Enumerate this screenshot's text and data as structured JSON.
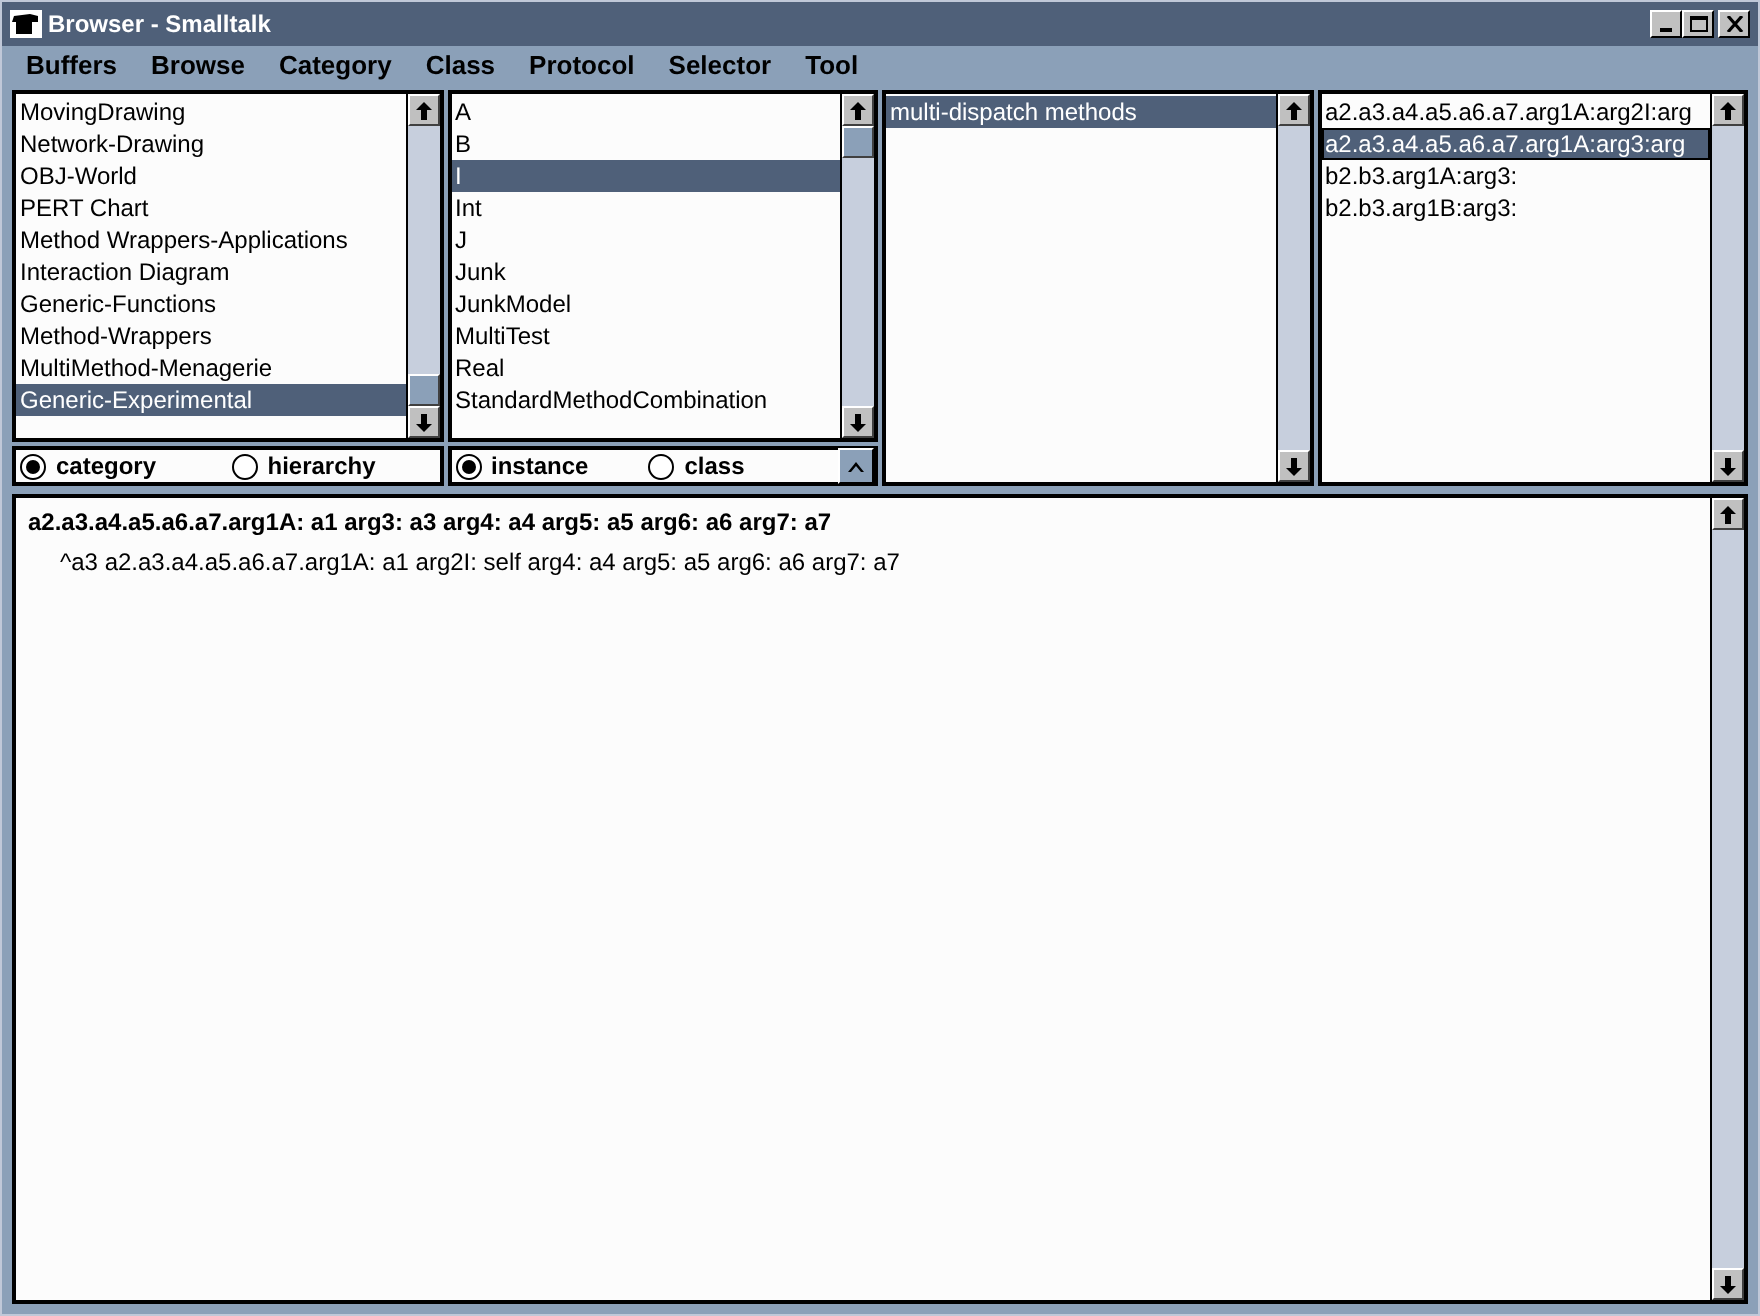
{
  "window": {
    "title": "Browser - Smalltalk"
  },
  "menu": [
    {
      "label": "Buffers"
    },
    {
      "label": "Browse"
    },
    {
      "label": "Category"
    },
    {
      "label": "Class"
    },
    {
      "label": "Protocol"
    },
    {
      "label": "Selector"
    },
    {
      "label": "Tool"
    }
  ],
  "categories": [
    {
      "label": "MovingDrawing",
      "selected": false
    },
    {
      "label": "Network-Drawing",
      "selected": false
    },
    {
      "label": "OBJ-World",
      "selected": false
    },
    {
      "label": "PERT Chart",
      "selected": false
    },
    {
      "label": "Method Wrappers-Applications",
      "selected": false
    },
    {
      "label": "Interaction Diagram",
      "selected": false
    },
    {
      "label": "Generic-Functions",
      "selected": false
    },
    {
      "label": "Method-Wrappers",
      "selected": false
    },
    {
      "label": "MultiMethod-Menagerie",
      "selected": false
    },
    {
      "label": "Generic-Experimental",
      "selected": true
    }
  ],
  "category_view": [
    {
      "label": "category",
      "selected": true
    },
    {
      "label": "hierarchy",
      "selected": false
    }
  ],
  "classes": [
    {
      "label": "A",
      "selected": false
    },
    {
      "label": "B",
      "selected": false
    },
    {
      "label": "I",
      "selected": true
    },
    {
      "label": "Int",
      "selected": false
    },
    {
      "label": "J",
      "selected": false
    },
    {
      "label": "Junk",
      "selected": false
    },
    {
      "label": "JunkModel",
      "selected": false
    },
    {
      "label": "MultiTest",
      "selected": false
    },
    {
      "label": "Real",
      "selected": false
    },
    {
      "label": "StandardMethodCombination",
      "selected": false
    }
  ],
  "class_side": [
    {
      "label": "instance",
      "selected": true
    },
    {
      "label": "class",
      "selected": false
    }
  ],
  "protocols": [
    {
      "label": "multi-dispatch methods",
      "selected": true
    }
  ],
  "selectors": [
    {
      "label": "a2.a3.a4.a5.a6.a7.arg1A:arg2I:arg",
      "selected": false
    },
    {
      "label": "a2.a3.a4.a5.a6.a7.arg1A:arg3:arg",
      "selected": true
    },
    {
      "label": "b2.b3.arg1A:arg3:",
      "selected": false
    },
    {
      "label": "b2.b3.arg1B:arg3:",
      "selected": false
    }
  ],
  "code": {
    "signature": "a2.a3.a4.a5.a6.a7.arg1A: a1 arg3: a3 arg4: a4 arg5: a5 arg6: a6 arg7: a7",
    "body": "^a3 a2.a3.a4.a5.a6.a7.arg1A: a1 arg2I: self arg4: a4 arg5: a5 arg6: a6 arg7: a7"
  }
}
